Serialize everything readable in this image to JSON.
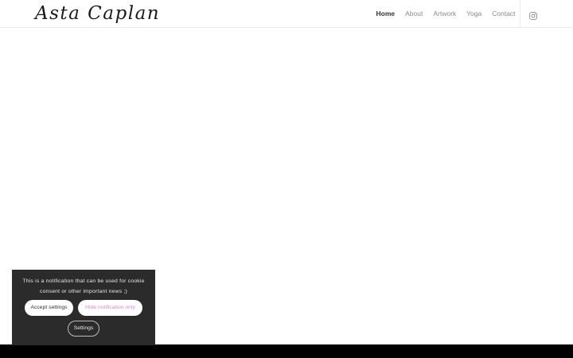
{
  "header": {
    "logo_text": "Asta Caplan",
    "nav": [
      {
        "label": "Home",
        "active": true
      },
      {
        "label": "About",
        "active": false
      },
      {
        "label": "Artwork",
        "active": false
      },
      {
        "label": "Yoga",
        "active": false
      },
      {
        "label": "Contact",
        "active": false
      }
    ],
    "social_icon": "instagram-icon"
  },
  "cookie_notice": {
    "message": "This is a notification that can be used for cookie consent or other important news ;)",
    "accept_label": "Accept settings",
    "hide_label": "Hide notification only",
    "settings_label": "Settings"
  },
  "colors": {
    "panel_bg": "#2b2b2b",
    "hide_link": "#d98ac8",
    "footer": "#000000"
  }
}
